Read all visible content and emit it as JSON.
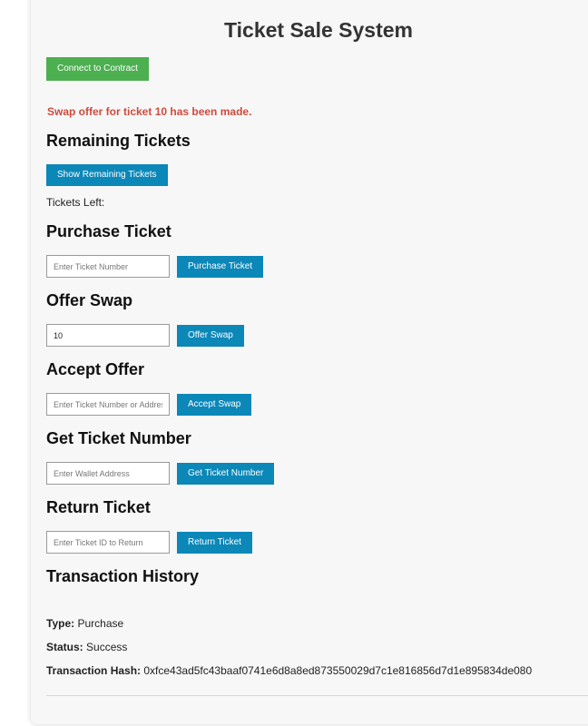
{
  "app": {
    "title": "Ticket Sale System",
    "connect_label": "Connect to Contract",
    "status_message": "Swap offer for ticket 10 has been made."
  },
  "remaining": {
    "heading": "Remaining Tickets",
    "button_label": "Show Remaining Tickets",
    "tickets_left_label": "Tickets Left:"
  },
  "purchase": {
    "heading": "Purchase Ticket",
    "placeholder": "Enter Ticket Number",
    "value": "",
    "button_label": "Purchase Ticket"
  },
  "offer_swap": {
    "heading": "Offer Swap",
    "placeholder": "",
    "value": "10",
    "button_label": "Offer Swap"
  },
  "accept_offer": {
    "heading": "Accept Offer",
    "placeholder": "Enter Ticket Number or Address",
    "value": "",
    "button_label": "Accept Swap"
  },
  "get_ticket": {
    "heading": "Get Ticket Number",
    "placeholder": "Enter Wallet Address",
    "value": "",
    "button_label": "Get Ticket Number"
  },
  "return_ticket": {
    "heading": "Return Ticket",
    "placeholder": "Enter Ticket ID to Return",
    "value": "",
    "button_label": "Return Ticket"
  },
  "history": {
    "heading": "Transaction History",
    "entries": [
      {
        "type_label": "Type:",
        "type_value": "Purchase",
        "status_label": "Status:",
        "status_value": "Success",
        "hash_label": "Transaction Hash:",
        "hash_value": "0xfce43ad5fc43baaf0741e6d8a8ed873550029d7c1e816856d7d1e895834de080"
      }
    ]
  },
  "colors": {
    "connect_button": "#4caf50",
    "action_button": "#0b87b8",
    "status_message": "#cc4b3f",
    "card_background": "#f7f7f7"
  }
}
